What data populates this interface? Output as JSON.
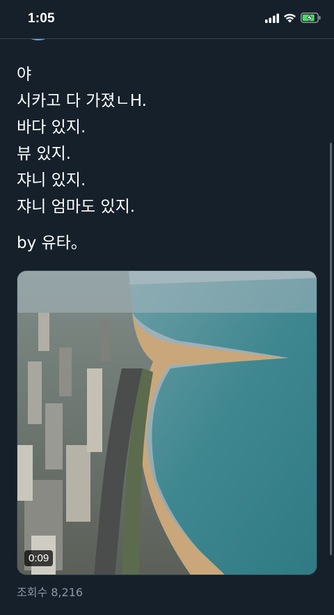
{
  "status_bar": {
    "time": "1:05",
    "icons": [
      "signal-icon",
      "wifi-icon",
      "battery-charging-icon"
    ]
  },
  "tweet": {
    "lines": [
      "야",
      "시카고 다 가졌ㄴH.",
      "바다 있지.",
      "뷰 있지.",
      "쟈니 있지.",
      "쟈니 엄마도 있지."
    ],
    "signoff": "by 유타。",
    "media": {
      "type": "video",
      "duration": "0:09"
    },
    "view_count": "조회수 8,216"
  },
  "colors": {
    "background": "#15202b",
    "text": "#ffffff",
    "secondary_text": "#8b98a5",
    "divider": "#38444d",
    "battery_charging": "#4cd964"
  }
}
